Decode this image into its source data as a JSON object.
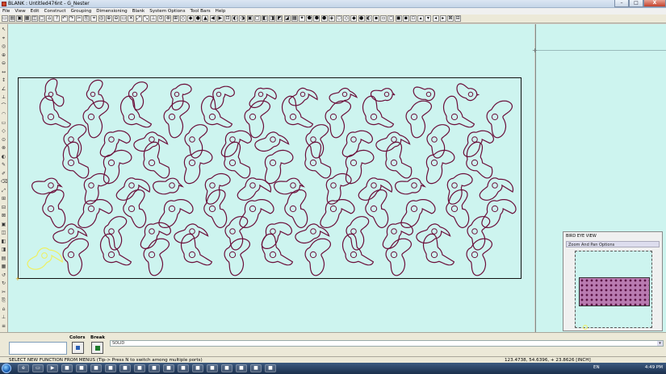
{
  "window": {
    "title": "BLANK : Untitled476nt - G_Nester",
    "buttons": {
      "minimize": "–",
      "maximize": "□",
      "close": "X"
    }
  },
  "menu": [
    "File",
    "View",
    "Edit",
    "Construct",
    "Grouping",
    "Dimensioning",
    "Blank",
    "System Options",
    "Tool Bars",
    "Help"
  ],
  "canvas": {
    "background": "#cdf4ef",
    "part_color": "#6b0f3a",
    "selected_part_color": "#eef060",
    "part_grid_columns": 12,
    "part_grid_rows": 4
  },
  "bird_eye": {
    "title": "BIRD EYE VIEW",
    "subtitle": "Zoom And Pan Options"
  },
  "bottom": {
    "colors_label": "Colors",
    "break_label": "Break",
    "layer_value": "SOLID"
  },
  "status": {
    "message": "SELECT NEW FUNCTION FROM MENUS (Tip-> Press N to switch among multiple ports)",
    "coordinates": "123.4738, 54.6396, + 23.8626  [INCH]"
  },
  "taskbar": {
    "language": "EN",
    "clock": "4:49 PM"
  }
}
